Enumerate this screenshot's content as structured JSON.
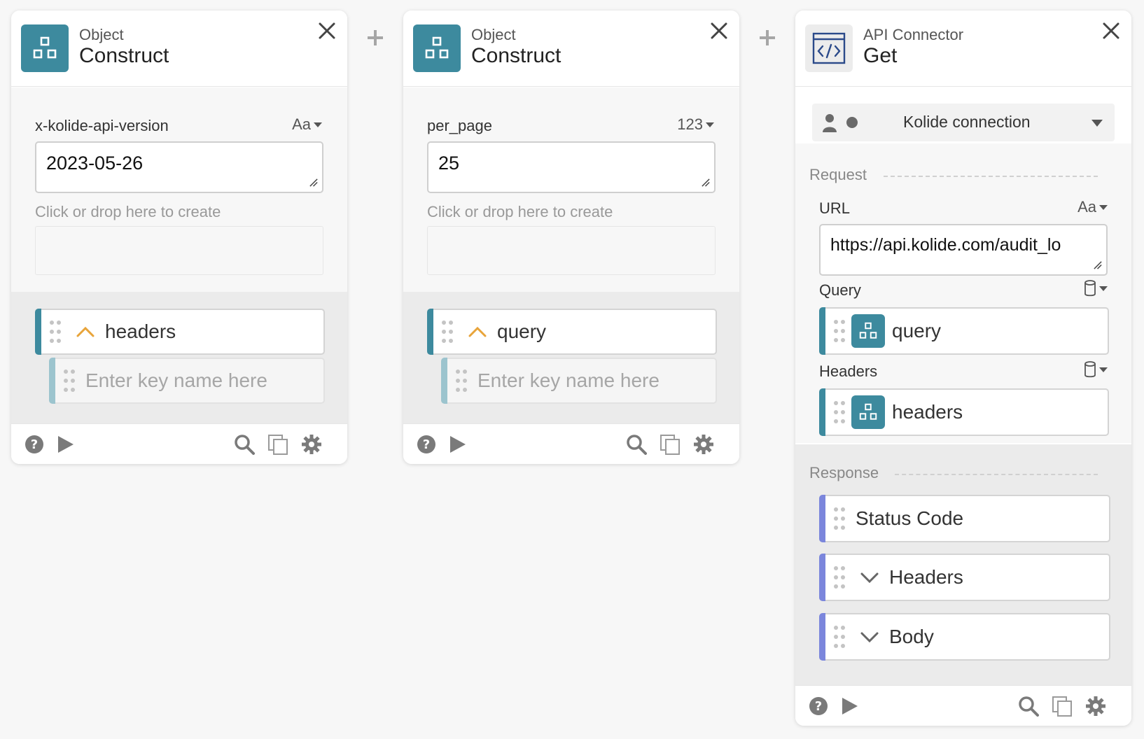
{
  "cards": [
    {
      "type": "Object",
      "title": "Construct",
      "field_label": "x-kolide-api-version",
      "field_type": "Aa",
      "field_value": "2023-05-26",
      "drop_hint": "Click or drop here to create",
      "key_name": "headers",
      "key_placeholder": "Enter key name here"
    },
    {
      "type": "Object",
      "title": "Construct",
      "field_label": "per_page",
      "field_type": "123",
      "field_value": "25",
      "drop_hint": "Click or drop here to create",
      "key_name": "query",
      "key_placeholder": "Enter key name here"
    }
  ],
  "api": {
    "type": "API Connector",
    "title": "Get",
    "connection": "Kolide connection",
    "request_label": "Request",
    "url_label": "URL",
    "url_type": "Aa",
    "url_value": "https://api.kolide.com/audit_lo",
    "query_label": "Query",
    "query_value": "query",
    "headers_label": "Headers",
    "headers_value": "headers",
    "response_label": "Response",
    "response_items": [
      "Status Code",
      "Headers",
      "Body"
    ]
  },
  "colors": {
    "accent_teal": "#3d8a9e",
    "response_stripe": "#7b86dc",
    "chevron_up": "#e8a43a"
  },
  "icons": [
    "object-icon",
    "close-icon",
    "add-step-icon",
    "help-icon",
    "run-icon",
    "search-icon",
    "copy-icon",
    "settings-icon",
    "api-code-icon",
    "user-icon",
    "chevron-up-icon",
    "chevron-down-icon",
    "drag-grip-icon",
    "database-icon"
  ]
}
